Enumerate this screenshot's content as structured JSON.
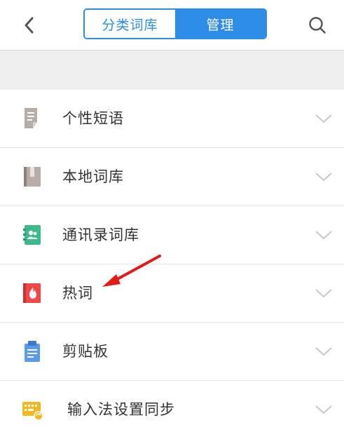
{
  "header": {
    "back_icon": "chevron-left-icon",
    "search_icon": "search-icon",
    "tabs": [
      {
        "label": "分类词库",
        "active": false
      },
      {
        "label": "管理",
        "active": true
      }
    ],
    "accent_color": "#2d8de6"
  },
  "list": {
    "items": [
      {
        "label": "个性短语",
        "icon": "document-icon",
        "icon_color": "#b8aca6"
      },
      {
        "label": "本地词库",
        "icon": "book-icon",
        "icon_color": "#b8aca6"
      },
      {
        "label": "通讯录词库",
        "icon": "contacts-book-icon",
        "icon_color": "#3dba8a"
      },
      {
        "label": "热词",
        "icon": "flame-book-icon",
        "icon_color": "#f04848"
      },
      {
        "label": "剪贴板",
        "icon": "clipboard-icon",
        "icon_color": "#5a9ae8"
      },
      {
        "label": "输入法设置同步",
        "icon": "keyboard-sync-icon",
        "icon_color": "#f3b81f"
      }
    ]
  },
  "annotation": {
    "type": "red-arrow",
    "target": "热词",
    "color": "#e11a1a"
  }
}
